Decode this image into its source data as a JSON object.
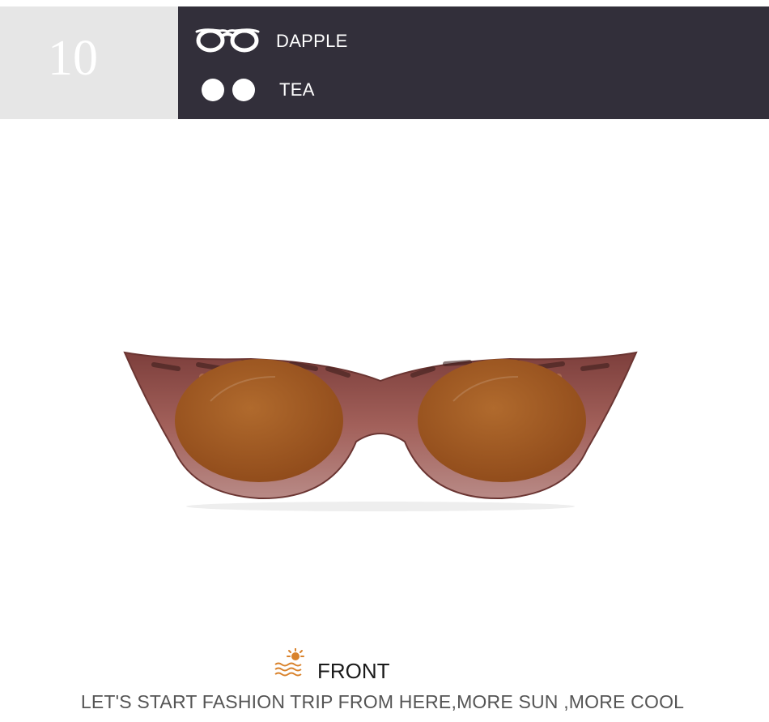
{
  "header": {
    "number": "10",
    "frame": {
      "icon": "glasses-frame-icon",
      "label": "DAPPLE"
    },
    "lens": {
      "icon": "lens-icon",
      "label": "TEA"
    }
  },
  "product": {
    "icon": "cat-eye-sunglasses-image"
  },
  "caption": {
    "icon": "sun-over-water-icon",
    "label": "FRONT",
    "slogan": "LET'S START FASHION TRIP FROM HERE,MORE SUN ,MORE COOL"
  },
  "colors": {
    "number_box": "#e6e6e6",
    "info_box": "#322f3a",
    "lens_tint": "#a2581f",
    "frame_tortoise": "#8a4b47",
    "caption_icon": "#d9822b"
  }
}
